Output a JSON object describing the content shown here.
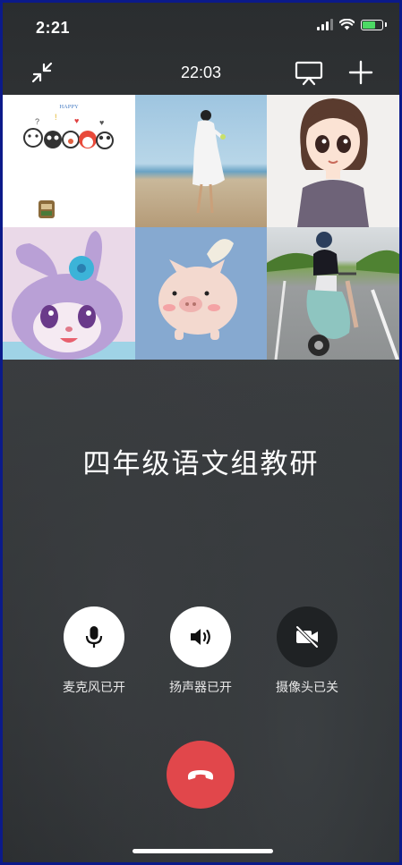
{
  "status_bar": {
    "time": "2:21"
  },
  "call": {
    "timer": "22:03",
    "title": "四年级语文组教研"
  },
  "participants": [
    {
      "avatar": "cartoon-faces-happy"
    },
    {
      "avatar": "woman-on-beach"
    },
    {
      "avatar": "anime-girl"
    },
    {
      "avatar": "bunny-cartoon"
    },
    {
      "avatar": "flying-pig-toy"
    },
    {
      "avatar": "woman-on-scooter"
    }
  ],
  "controls": {
    "mic": {
      "label": "麦克风已开",
      "icon": "microphone-icon"
    },
    "speaker": {
      "label": "扬声器已开",
      "icon": "speaker-icon"
    },
    "camera": {
      "label": "摄像头已关",
      "icon": "camera-off-icon"
    }
  },
  "colors": {
    "hangup": "#e1474b",
    "frame": "#0b1a8a"
  },
  "avatar_text": {
    "happy": "HAPPY"
  }
}
